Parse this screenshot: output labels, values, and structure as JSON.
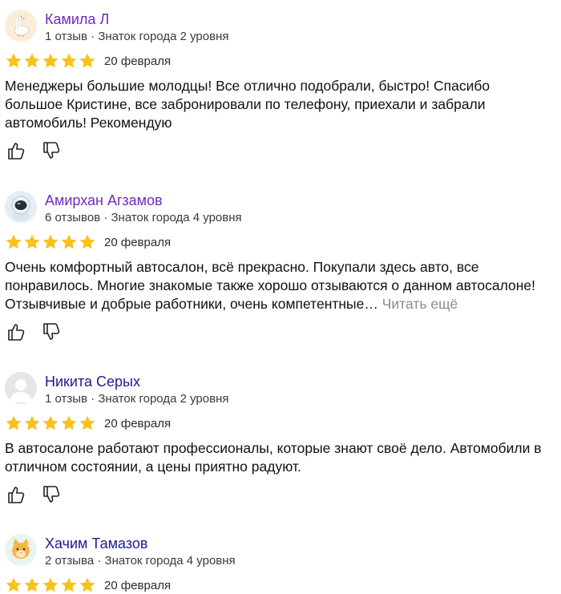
{
  "reviews": [
    {
      "name": "Камила Л",
      "name_color": "#6e2cc2",
      "avatar_icon": "goose-avatar-icon",
      "meta": "1 отзыв · Знаток города 2 уровня",
      "rating": 5,
      "date": "20 февраля",
      "text": "Менеджеры большие молодцы! Все отлично подобрали, быстро! Спасибо большое Кристине, все забронировали по телефону, приехали и забрали автомобиль! Рекомендую"
    },
    {
      "name": "Амирхан Агзамов",
      "name_color": "#6e2cc2",
      "avatar_icon": "astronaut-avatar-icon",
      "meta": "6 отзывов · Знаток города 4 уровня",
      "rating": 5,
      "date": "20 февраля",
      "text": "Очень комфортный автосалон, всё прекрасно. Покупали здесь авто, все понравилось. Многие знакомые также хорошо отзываются о данном автосалоне! Отзывчивые и добрые работники, очень компетентные…",
      "read_more": "Читать ещё"
    },
    {
      "name": "Никита Серых",
      "name_color": "#1c1c8f",
      "avatar_icon": "default-user-avatar-icon",
      "meta": "1 отзыв · Знаток города 2 уровня",
      "rating": 5,
      "date": "20 февраля",
      "text": "В автосалоне работают профессионалы, которые знают своё дело. Автомобили в отличном состоянии, а цены приятно радуют."
    },
    {
      "name": "Хачим Тамазов",
      "name_color": "#1c1c8f",
      "avatar_icon": "cat-avatar-icon",
      "meta": "2 отзыва · Знаток города 4 уровня",
      "rating": 5,
      "date": "20 февраля"
    }
  ],
  "colors": {
    "star": "#f8c21c",
    "text": "#111111",
    "meta": "#3a3a3a",
    "read_more": "#8c8c8c"
  }
}
